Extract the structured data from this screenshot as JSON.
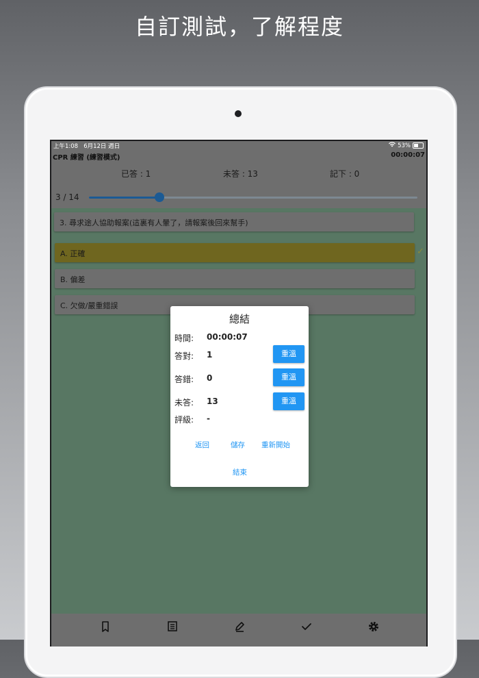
{
  "headline": "自訂測試，了解程度",
  "status_bar": {
    "time": "上午1:08",
    "date": "6月12日 週日",
    "battery_text": "53%",
    "battery_level": 0.53
  },
  "nav": {
    "app_title": "CPR 練習 (練習模式)",
    "timer": "00:00:07"
  },
  "stats": {
    "answered": "已答 : 1",
    "unanswered": "未答 : 13",
    "bookmarked": "記下 : 0"
  },
  "progress": {
    "label": "3 / 14",
    "current": 3,
    "total": 14
  },
  "question": {
    "text": "3. 尋求途人協助報案(這裏有人暈了，請報案後回來幫手)"
  },
  "options": [
    {
      "label": "A. 正確",
      "selected": true
    },
    {
      "label": "B. 偏差",
      "selected": false
    },
    {
      "label": "C. 欠做/嚴重錯誤",
      "selected": false
    }
  ],
  "dialog": {
    "title": "總結",
    "rows": [
      {
        "label": "時間:",
        "value": "00:00:07"
      },
      {
        "label": "答對:",
        "value": "1",
        "button": "重溫"
      },
      {
        "label": "答錯:",
        "value": "0",
        "button": "重溫"
      },
      {
        "label": "未答:",
        "value": "13",
        "button": "重溫"
      },
      {
        "label": "評級:",
        "value": "-"
      }
    ],
    "actions": {
      "back": "返回",
      "save": "儲存",
      "restart": "重新開始",
      "finish": "結束"
    }
  },
  "bottom_bar": {
    "icons": [
      "bookmark-icon",
      "list-icon",
      "edit-icon",
      "check-icon",
      "gear-icon"
    ]
  },
  "colors": {
    "accent": "#2196f3",
    "slider": "#1b5a94",
    "content_background": "#587763",
    "selected_option": "#6f661f"
  }
}
